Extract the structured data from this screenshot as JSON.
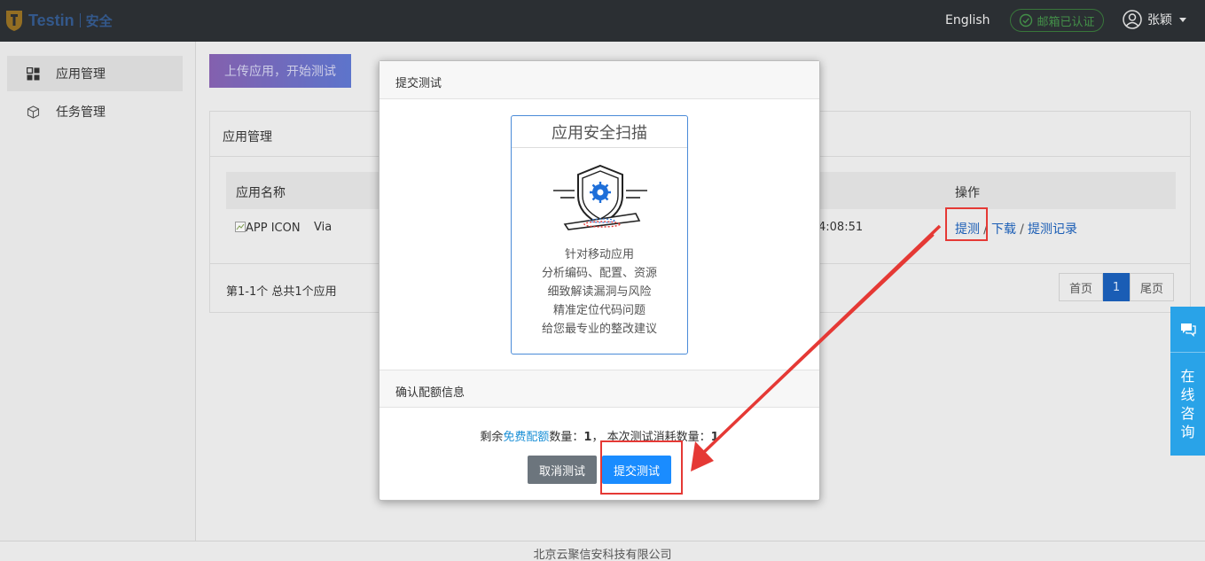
{
  "brand": {
    "name": "Testin",
    "sub": "安全"
  },
  "header": {
    "language": "English",
    "verified": "邮箱已认证",
    "username": "张颖"
  },
  "sidebar": {
    "items": [
      {
        "label": "应用管理"
      },
      {
        "label": "任务管理"
      }
    ]
  },
  "main": {
    "upload_button": "上传应用，开始测试",
    "panel_title": "应用管理",
    "table": {
      "headers": [
        "应用名称",
        "操作"
      ],
      "row": {
        "icon_alt": "APP ICON",
        "name": "Via",
        "time_fragment": "4:08:51"
      },
      "actions": {
        "test": "提测",
        "download": "下载",
        "records": "提测记录",
        "sep": "/"
      }
    },
    "summary": "第1-1个 总共1个应用",
    "pager": {
      "first": "首页",
      "current": "1",
      "last": "尾页"
    }
  },
  "modal": {
    "title": "提交测试",
    "card": {
      "title": "应用安全扫描",
      "lines": [
        "针对移动应用",
        "分析编码、配置、资源",
        "细致解读漏洞与风险",
        "精准定位代码问题",
        "给您最专业的整改建议"
      ]
    },
    "confirm_title": "确认配额信息",
    "quota": {
      "prefix": "剩余",
      "highlight": "免费配额",
      "mid": "数量：",
      "remaining": "1",
      "sep": "， 本次测试消耗数量：",
      "cost": "1"
    },
    "cancel_button": "取消测试",
    "submit_button": "提交测试"
  },
  "consult": {
    "label": "在线咨询"
  },
  "footer": {
    "text": "北京云聚信安科技有限公司"
  },
  "colors": {
    "accent": "#1a8cff",
    "annotation": "#e53935",
    "topbar": "#2b2f33"
  }
}
